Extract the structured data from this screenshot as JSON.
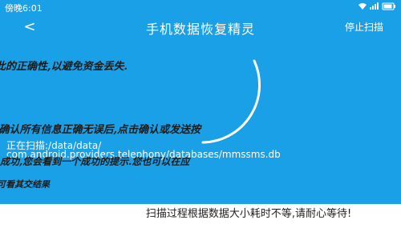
{
  "status_bar": {
    "time": "傍晚6:01",
    "icons": [
      "wifi-icon",
      "signal-icon",
      "battery-icon"
    ]
  },
  "header": {
    "back_label": "<",
    "title": "手机数据恢复精灵",
    "stop_scan_label": "停止扫描"
  },
  "overlay_text": {
    "line1": "此的正确性,以避免资金丢失.",
    "line2": "·确认所有信息正确无误后,点击确认或发送按",
    "line3": "成功,您会看到一个成功的提示.您也可以在应",
    "line4": "可看其交结果"
  },
  "scan": {
    "label": "正在扫描:/data/data/",
    "path": "com.android.providers.telephony/databases/mmssms.db"
  },
  "footer": {
    "message": "扫描过程根据数据大小耗时不等,请耐心等待!"
  },
  "colors": {
    "header_bg": "#1aa0e6",
    "content_bg": "#1aa0e6",
    "spinner": "#ffffff",
    "footer_bg": "#ffffff"
  }
}
